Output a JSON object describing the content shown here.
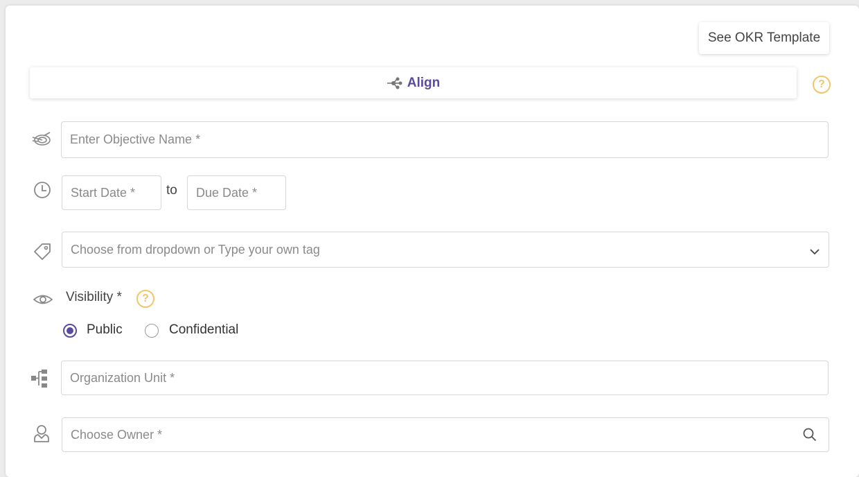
{
  "header": {
    "template_button": "See OKR Template",
    "align_button": "Align"
  },
  "form": {
    "objective": {
      "placeholder": "Enter Objective Name *"
    },
    "start_date": {
      "placeholder": "Start Date *"
    },
    "date_separator": "to",
    "due_date": {
      "placeholder": "Due Date *"
    },
    "tags": {
      "placeholder": "Choose from dropdown or Type your own tag"
    },
    "visibility": {
      "label": "Visibility *",
      "options": [
        {
          "label": "Public",
          "selected": true
        },
        {
          "label": "Confidential",
          "selected": false
        }
      ]
    },
    "org_unit": {
      "placeholder": "Organization Unit *"
    },
    "owner": {
      "placeholder": "Choose Owner *"
    }
  },
  "icons": {
    "objective": "target-icon",
    "dates": "clock-icon",
    "tags": "tag-icon",
    "visibility": "eye-icon",
    "org_unit": "hierarchy-icon",
    "owner": "user-icon",
    "help": "help-icon"
  },
  "colors": {
    "accent": "#5b4a9e",
    "help": "#f3c46b",
    "border": "#d7d7d7"
  }
}
